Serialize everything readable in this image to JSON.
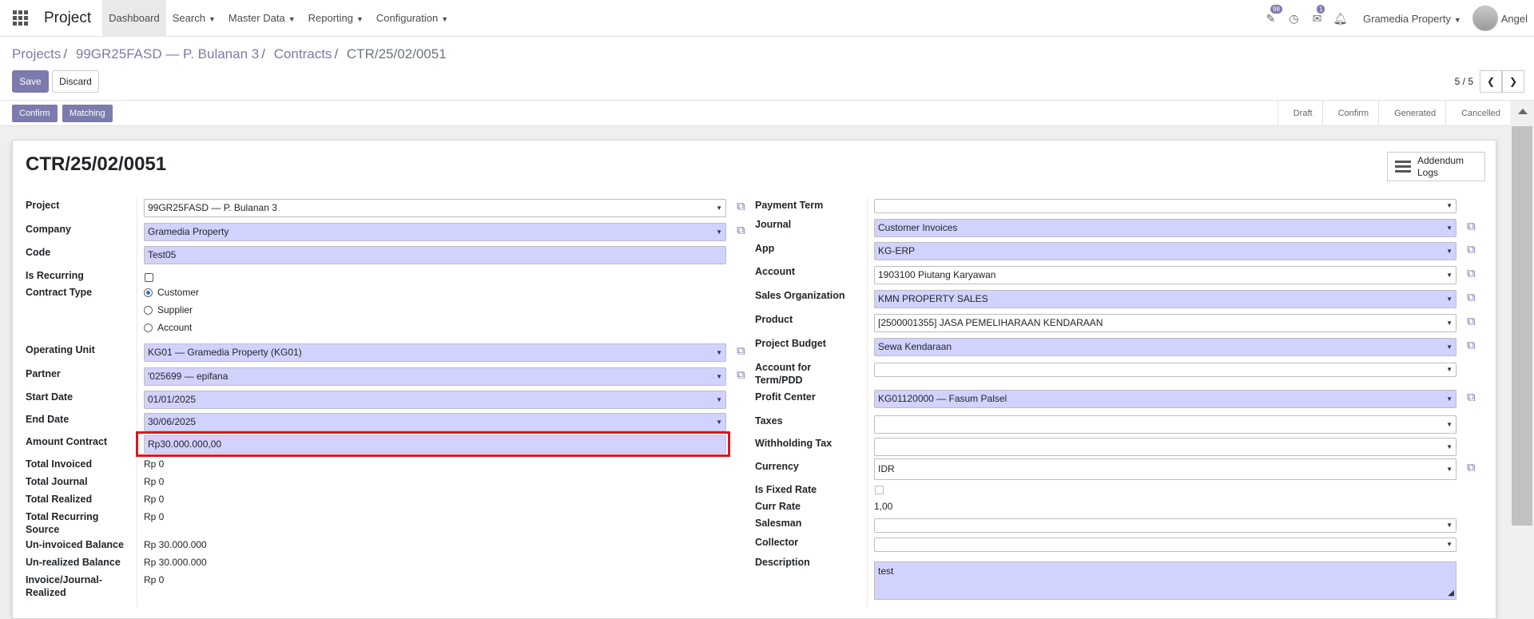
{
  "navbar": {
    "brand": "Project",
    "menus": [
      "Dashboard",
      "Search",
      "Master Data",
      "Reporting",
      "Configuration"
    ],
    "badges": {
      "activity": "98",
      "messages": "1"
    },
    "company": "Gramedia Property",
    "user": "Angel"
  },
  "breadcrumb": {
    "items": [
      "Projects",
      "99GR25FASD — P. Bulanan 3",
      "Contracts"
    ],
    "current": "CTR/25/02/0051"
  },
  "buttons": {
    "save": "Save",
    "discard": "Discard",
    "confirm": "Confirm",
    "matching": "Matching",
    "addendum": "Addendum Logs"
  },
  "pager": {
    "value": "5 / 5"
  },
  "stages": [
    "Draft",
    "Confirm",
    "Generated",
    "Cancelled"
  ],
  "record": {
    "title": "CTR/25/02/0051"
  },
  "left": {
    "labels": {
      "project": "Project",
      "company": "Company",
      "code": "Code",
      "is_recurring": "Is Recurring",
      "contract_type": "Contract Type",
      "operating_unit": "Operating Unit",
      "partner": "Partner",
      "start_date": "Start Date",
      "end_date": "End Date",
      "amount_contract": "Amount Contract",
      "total_invoiced": "Total Invoiced",
      "total_journal": "Total Journal",
      "total_realized": "Total Realized",
      "total_recurring_source": "Total Recurring Source",
      "uninvoiced_balance": "Un-invoiced Balance",
      "unrealized_balance": "Un-realized Balance",
      "invoice_journal_realized": "Invoice/Journal-Realized"
    },
    "values": {
      "project": "99GR25FASD — P. Bulanan 3",
      "company": "Gramedia Property",
      "code": "Test05",
      "operating_unit": "KG01 — Gramedia Property (KG01)",
      "partner": "'025699 — epifana",
      "start_date": "01/01/2025",
      "end_date": "30/06/2025",
      "amount_contract": "Rp30.000.000,00",
      "total_invoiced": "Rp 0",
      "total_journal": "Rp 0",
      "total_realized": "Rp 0",
      "total_recurring_source": "Rp 0",
      "uninvoiced_balance": "Rp 30.000.000",
      "unrealized_balance": "Rp 30.000.000",
      "invoice_journal_realized": "Rp 0"
    },
    "contract_types": [
      "Customer",
      "Supplier",
      "Account"
    ],
    "contract_type_selected": "Customer"
  },
  "right": {
    "labels": {
      "payment_term": "Payment Term",
      "journal": "Journal",
      "app": "App",
      "account": "Account",
      "sales_org": "Sales Organization",
      "product": "Product",
      "project_budget": "Project Budget",
      "account_term": "Account for Term/PDD",
      "profit_center": "Profit Center",
      "taxes": "Taxes",
      "withholding_tax": "Withholding Tax",
      "currency": "Currency",
      "is_fixed_rate": "Is Fixed Rate",
      "curr_rate": "Curr Rate",
      "salesman": "Salesman",
      "collector": "Collector",
      "description": "Description"
    },
    "values": {
      "payment_term": "",
      "journal": "Customer Invoices",
      "app": "KG-ERP",
      "account": "1903100 Piutang Karyawan",
      "sales_org": "KMN PROPERTY SALES",
      "product": "[2500001355] JASA PEMELIHARAAN KENDARAAN",
      "project_budget": "Sewa Kendaraan",
      "account_term": "",
      "profit_center": "KG01120000 — Fasum Palsel",
      "taxes": "",
      "withholding_tax": "",
      "currency": "IDR",
      "curr_rate": "1,00",
      "salesman": "",
      "collector": "",
      "description": "test"
    }
  },
  "colors": {
    "primary": "#7c7bad",
    "required_field": "#d2d2ff",
    "highlight": "#e0141e"
  }
}
